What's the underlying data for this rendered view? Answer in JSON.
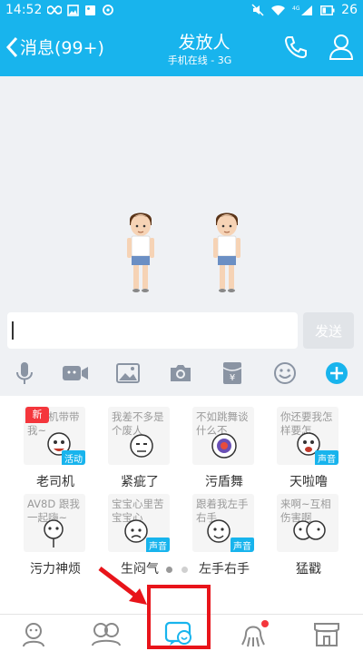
{
  "status_bar": {
    "time": "14:52",
    "network": "4G",
    "battery": "26"
  },
  "header": {
    "back_label": "消息(99+)",
    "title": "发放人",
    "subtitle": "手机在线 - 3G"
  },
  "input": {
    "value": "",
    "placeholder": "",
    "send_label": "发送"
  },
  "toolbar": {
    "icons": [
      "microphone-icon",
      "video-icon",
      "image-icon",
      "camera-icon",
      "red-packet-icon",
      "emoji-icon",
      "plus-icon"
    ]
  },
  "stickers": {
    "new_badge": "新",
    "items": [
      {
        "text": "老司机带带我~",
        "label": "老司机",
        "badge": "活动"
      },
      {
        "text": "我差不多是个废人",
        "label": "紧疵了",
        "badge": ""
      },
      {
        "text": "不如跳舞谈什么不",
        "label": "污盾舞",
        "badge": ""
      },
      {
        "text": "你还要我怎样要怎",
        "label": "天啦噜",
        "badge": "声音"
      },
      {
        "text": "AV8D 跟我一起嗨~",
        "label": "污力神烦",
        "badge": ""
      },
      {
        "text": "宝宝心里苦宝宝心",
        "label": "生闷气",
        "badge": "声音"
      },
      {
        "text": "跟着我左手右手",
        "label": "左手右手",
        "badge": "声音"
      },
      {
        "text": "来啊~互相伤害啊",
        "label": "猛戳",
        "badge": ""
      }
    ]
  },
  "bottom_tabs": {
    "icons": [
      "contact-face-icon",
      "friends-icon",
      "sticker-tab-icon",
      "octopus-icon",
      "store-icon"
    ]
  },
  "colors": {
    "brand": "#18b4ed",
    "chat_background": "#eff1f4",
    "highlight": "#e8141a"
  }
}
